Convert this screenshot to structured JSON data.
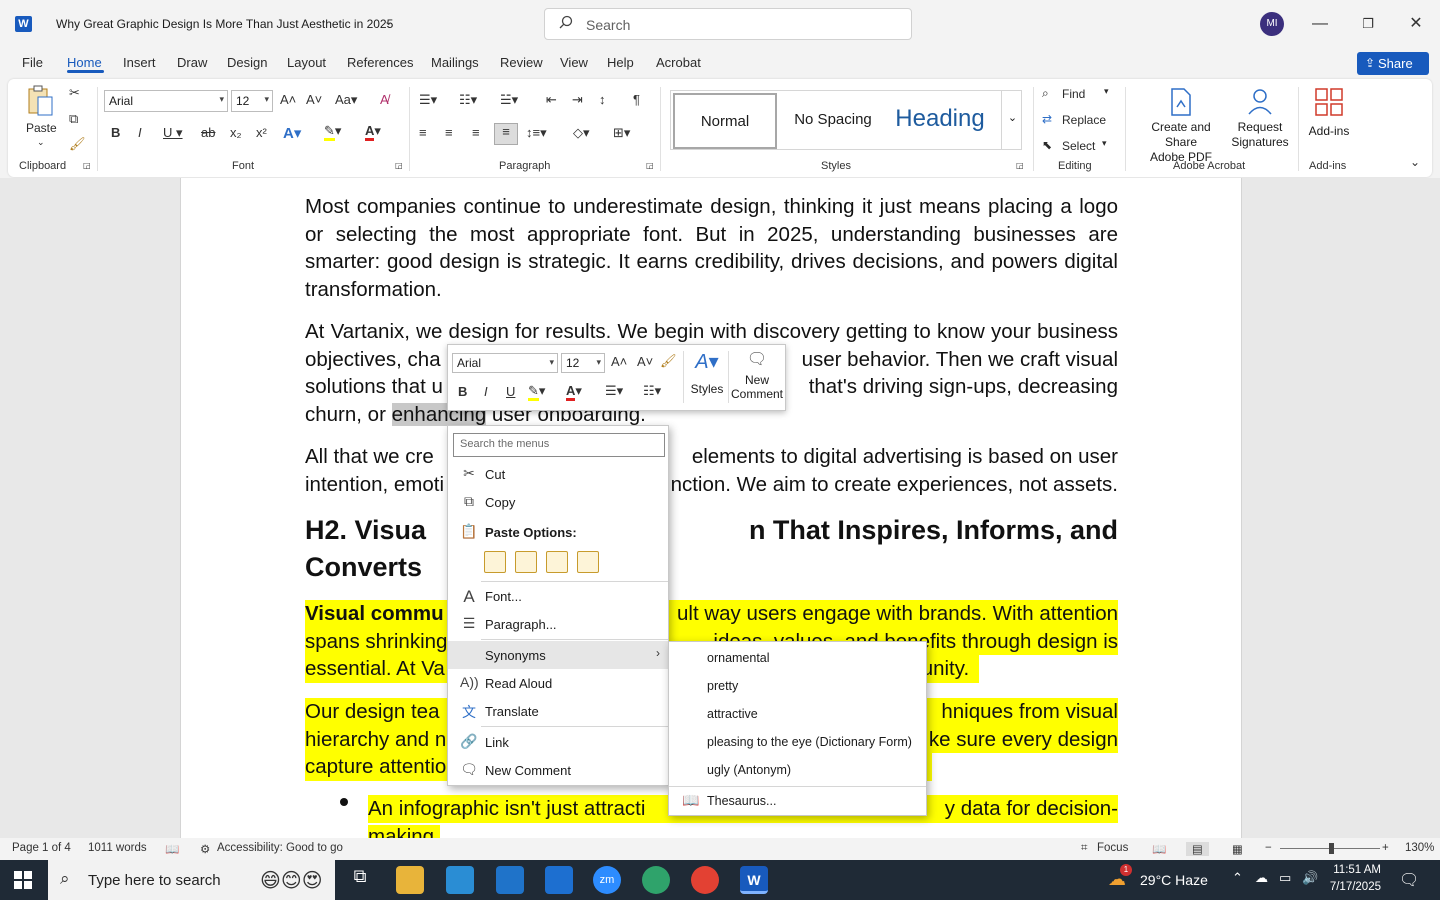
{
  "window": {
    "title": "Why Great Graphic Design Is More Than Just Aesthetic in 2025",
    "search_placeholder": "Search",
    "avatar_initials": "MI"
  },
  "tabs": [
    "File",
    "Home",
    "Insert",
    "Draw",
    "Design",
    "Layout",
    "References",
    "Mailings",
    "Review",
    "View",
    "Help",
    "Acrobat"
  ],
  "share_label": "Share",
  "ribbon": {
    "clipboard": {
      "paste": "Paste",
      "group": "Clipboard"
    },
    "font": {
      "name": "Arial",
      "size": "12",
      "group": "Font"
    },
    "paragraph": {
      "group": "Paragraph"
    },
    "styles": {
      "items": [
        "Normal",
        "No Spacing",
        "Heading"
      ],
      "group": "Styles"
    },
    "editing": {
      "find": "Find",
      "replace": "Replace",
      "select": "Select",
      "group": "Editing"
    },
    "adobe": {
      "create_share": "Create and Share",
      "adobe_pdf": "Adobe PDF",
      "request": "Request",
      "signatures": "Signatures",
      "group": "Adobe Acrobat"
    },
    "addins": {
      "label": "Add-ins",
      "group": "Add-ins"
    }
  },
  "document": {
    "p1": [
      "Most companies continue to underestimate design, thinking it just means placing a logo",
      "or selecting the most appropriate font. But in 2025, understanding businesses are",
      "smarter: good design is strategic. It earns credibility, drives decisions, and powers digital",
      "transformation."
    ],
    "p2": {
      "l1": "At Vartanix, we design for results. We begin with discovery getting to know your business",
      "l2a": "objectives, cha",
      "l2b": "user behavior. Then we craft visual",
      "l3a": "solutions that u",
      "l3b": "that's driving sign-ups, decreasing",
      "l4a": "churn, or ",
      "l4sel": "enhancing",
      "l4b": " user onboarding."
    },
    "p3": {
      "l1a": "All that we cre",
      "l1b": "elements to digital advertising is based on user",
      "l2a": "intention, emoti",
      "l2b": "nction. We aim to create experiences, not assets."
    },
    "h2": {
      "l1a": "H2. Visua",
      "l1b": "n That Inspires, Informs, and",
      "l2": "Converts"
    },
    "p4": {
      "l1a": "Visual commu",
      "l1b": "ult way users engage with brands. With attention",
      "l2a": "spans shrinking",
      "l2b": "ideas, values, and benefits through design is",
      "l3a": "essential. At Va",
      "l3b": "tunity."
    },
    "p5": {
      "l1a": "Our design tea",
      "l1b": "hniques from visual",
      "l2a": "hierarchy and n",
      "l2b": "ke sure every design",
      "l3a": "capture attentio",
      "l3b": ":"
    },
    "bullet": {
      "l1a": "An infographic isn't just attracti",
      "l1b": "y data for decision-",
      "l2": "making."
    }
  },
  "mini_toolbar": {
    "font": "Arial",
    "size": "12",
    "styles": "Styles",
    "new_comment_1": "New",
    "new_comment_2": "Comment"
  },
  "context_menu": {
    "search_placeholder": "Search the menus",
    "cut": "Cut",
    "copy": "Copy",
    "paste_options": "Paste Options:",
    "font": "Font...",
    "paragraph": "Paragraph...",
    "synonyms": "Synonyms",
    "read_aloud": "Read Aloud",
    "translate": "Translate",
    "link": "Link",
    "new_comment": "New Comment"
  },
  "synonyms": [
    "ornamental",
    "pretty",
    "attractive",
    "pleasing to the eye (Dictionary Form)",
    "ugly (Antonym)"
  ],
  "thesaurus": "Thesaurus...",
  "status": {
    "page": "Page 1 of 4",
    "words": "1011 words",
    "accessibility": "Accessibility: Good to go",
    "focus": "Focus",
    "zoom": "130%"
  },
  "taskbar": {
    "search": "Type here to search",
    "weather": "29°C  Haze",
    "time": "11:51 AM",
    "date": "7/17/2025",
    "weather_badge": "1"
  },
  "colors": {
    "accent": "#185abd",
    "highlight": "#ffff00",
    "selection": "#c8c8c8"
  }
}
